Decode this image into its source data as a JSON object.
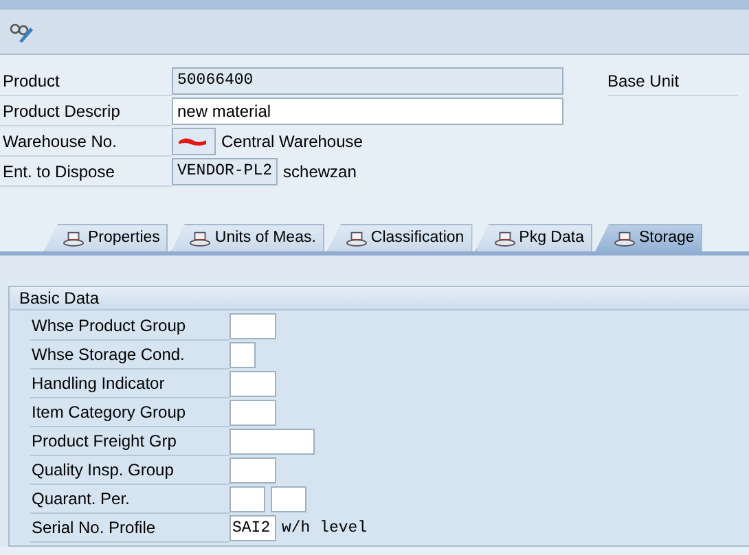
{
  "header": [
    {
      "label": "Product",
      "value": "50066400",
      "kind": "display",
      "extra_label": "Base Unit"
    },
    {
      "label": "Product Descrip",
      "value": "new material",
      "kind": "input"
    },
    {
      "label": "Warehouse No.",
      "kind": "redacted",
      "description": "Central Warehouse"
    },
    {
      "label": "Ent. to Dispose",
      "value": "VENDOR-PL2",
      "kind": "display",
      "description": "schewzan"
    }
  ],
  "tabs": [
    {
      "label": "Properties",
      "selected": false
    },
    {
      "label": "Units of Meas.",
      "selected": false
    },
    {
      "label": "Classification",
      "selected": false
    },
    {
      "label": "Pkg Data",
      "selected": false
    },
    {
      "label": "Storage",
      "selected": true
    }
  ],
  "group": {
    "title": "Basic Data",
    "rows": [
      {
        "label": "Whse Product Group"
      },
      {
        "label": "Whse Storage Cond."
      },
      {
        "label": "Handling Indicator"
      },
      {
        "label": "Item Category Group"
      },
      {
        "label": "Product Freight Grp"
      },
      {
        "label": "Quality Insp. Group"
      },
      {
        "label": "Quarant. Per."
      },
      {
        "label": "Serial No. Profile",
        "value": "SAI2",
        "description": "w/h level"
      }
    ]
  }
}
